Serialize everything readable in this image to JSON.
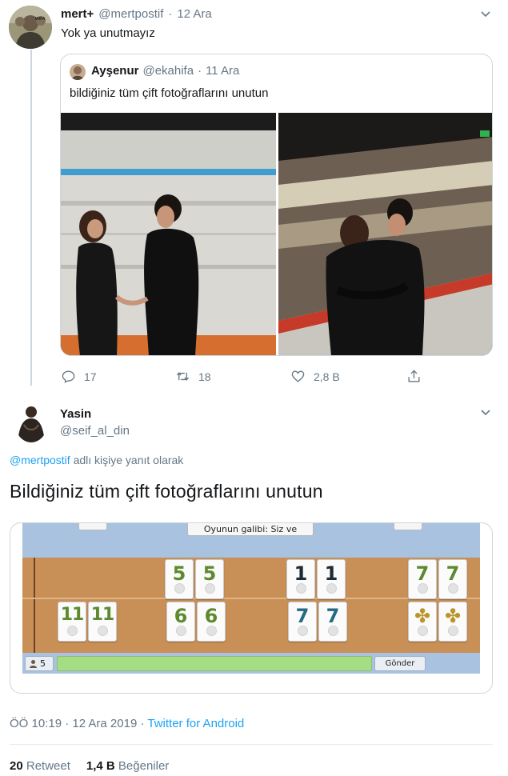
{
  "tweet": {
    "author_name": "mert+",
    "author_handle": "@mertpostif",
    "date": "12 Ara",
    "text": "Yok ya unutmayız",
    "avatar_badge": "WIFA",
    "quote": {
      "author_name": "Ayşenur",
      "author_handle": "@ekahifa",
      "date": "11 Ara",
      "text": "bildiğiniz tüm çift fotoğraflarını unutun"
    },
    "actions": {
      "replies": "17",
      "retweets": "18",
      "likes": "2,8 B"
    }
  },
  "reply": {
    "author_name": "Yasin",
    "author_handle": "@seif_al_din",
    "reply_to_handle": "@mertpostif",
    "reply_to_suffix": "adlı kişiye yanıt olarak",
    "text": "Bildiğiniz tüm çift fotoğraflarını unutun",
    "game": {
      "banner": "Oyunun galibi: Siz ve Buğra!",
      "player_count": "5",
      "send_button": "Gönder",
      "row1": [
        "5",
        "5",
        "1",
        "1",
        "7",
        "7"
      ],
      "row2": [
        "11",
        "11",
        "6",
        "6",
        "7",
        "7",
        "✤",
        "✤"
      ],
      "colors": {
        "green": "#5d8a2e",
        "black": "#1f2a33",
        "teal": "#266a80",
        "gold": "#b9962a"
      }
    },
    "meta": {
      "time": "ÖÖ 10:19",
      "date": "12 Ara 2019",
      "separator": "·",
      "source": "Twitter for Android"
    },
    "stats": {
      "retweets_count": "20",
      "retweets_label": "Retweet",
      "likes_count": "1,4 B",
      "likes_label": "Beğeniler"
    }
  }
}
